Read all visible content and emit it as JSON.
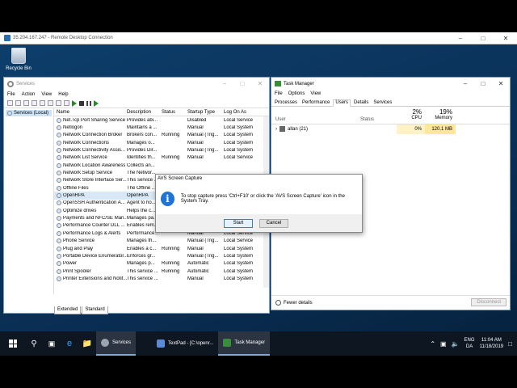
{
  "rdp": {
    "title": "35.204.167.247 - Remote Desktop Connection"
  },
  "desktop": {
    "recycle_bin": "Recycle Bin"
  },
  "services": {
    "title": "Services",
    "menu": [
      "File",
      "Action",
      "View",
      "Help"
    ],
    "tree_node": "Services (Local)",
    "headers": {
      "name": "Name",
      "description": "Description",
      "status": "Status",
      "startup": "Startup Type",
      "logon": "Log On As"
    },
    "rows": [
      {
        "name": "Net.Tcp Port Sharing Service",
        "desc": "Provides abi...",
        "status": "",
        "startup": "Disabled",
        "logon": "Local Service"
      },
      {
        "name": "Netlogon",
        "desc": "Maintains a ...",
        "status": "",
        "startup": "Manual",
        "logon": "Local System"
      },
      {
        "name": "Network Connection Broker",
        "desc": "Brokers con...",
        "status": "Running",
        "startup": "Manual (Trig...",
        "logon": "Local System"
      },
      {
        "name": "Network Connections",
        "desc": "Manages o...",
        "status": "",
        "startup": "Manual",
        "logon": "Local System"
      },
      {
        "name": "Network Connectivity Assis...",
        "desc": "Provides Dir...",
        "status": "",
        "startup": "Manual (Trig...",
        "logon": "Local System"
      },
      {
        "name": "Network List Service",
        "desc": "Identifies th...",
        "status": "Running",
        "startup": "Manual",
        "logon": "Local Service"
      },
      {
        "name": "Network Location Awareness",
        "desc": "Collects an...",
        "status": "",
        "startup": "",
        "logon": ""
      },
      {
        "name": "Network Setup Service",
        "desc": "The Networ...",
        "status": "",
        "startup": "",
        "logon": ""
      },
      {
        "name": "Network Store Interface Ser...",
        "desc": "This service ...",
        "status": "",
        "startup": "",
        "logon": ""
      },
      {
        "name": "Offline Files",
        "desc": "The Offline ...",
        "status": "",
        "startup": "",
        "logon": ""
      },
      {
        "name": "OpenRPA",
        "desc": "OpenRPA",
        "status": "",
        "startup": "",
        "logon": ""
      },
      {
        "name": "OpenSSH Authentication A...",
        "desc": "Agent to ho...",
        "status": "",
        "startup": "",
        "logon": ""
      },
      {
        "name": "Optimize drives",
        "desc": "Helps the c...",
        "status": "",
        "startup": "",
        "logon": ""
      },
      {
        "name": "Payments and NFC/SE Man...",
        "desc": "Manages pa...",
        "status": "",
        "startup": "Manual (Trig...",
        "logon": "Local Service"
      },
      {
        "name": "Performance Counter DLL ...",
        "desc": "Enables rem...",
        "status": "",
        "startup": "Manual",
        "logon": "Local Service"
      },
      {
        "name": "Performance Logs & Alerts",
        "desc": "Performance...",
        "status": "",
        "startup": "Manual",
        "logon": "Local Service"
      },
      {
        "name": "Phone Service",
        "desc": "Manages th...",
        "status": "",
        "startup": "Manual (Trig...",
        "logon": "Local Service"
      },
      {
        "name": "Plug and Play",
        "desc": "Enables a c...",
        "status": "Running",
        "startup": "Manual",
        "logon": "Local System"
      },
      {
        "name": "Portable Device Enumerator...",
        "desc": "Enforces gr...",
        "status": "",
        "startup": "Manual (Trig...",
        "logon": "Local System"
      },
      {
        "name": "Power",
        "desc": "Manages p...",
        "status": "Running",
        "startup": "Automatic",
        "logon": "Local System"
      },
      {
        "name": "Print Spooler",
        "desc": "This service ...",
        "status": "Running",
        "startup": "Automatic",
        "logon": "Local System"
      },
      {
        "name": "Printer Extensions and Notif...",
        "desc": "This service ...",
        "status": "",
        "startup": "Manual",
        "logon": "Local System"
      }
    ],
    "tabs": [
      "Extended",
      "Standard"
    ]
  },
  "taskmanager": {
    "title": "Task Manager",
    "menu": [
      "File",
      "Options",
      "View"
    ],
    "tabs": [
      "Processes",
      "Performance",
      "Users",
      "Details",
      "Services"
    ],
    "active_tab": "Users",
    "cols": {
      "user": "User",
      "status": "Status",
      "cpu_pct": "2%",
      "cpu": "CPU",
      "mem_pct": "19%",
      "mem": "Memory"
    },
    "user_row": {
      "name": "allan (21)",
      "cpu": "0%",
      "mem": "120.1 MB"
    },
    "fewer": "Fewer details",
    "disconnect": "Disconnect"
  },
  "dialog": {
    "title": "AVS Screen Capture",
    "message": "To stop capture press 'Ctrl+F10' or click the 'AVS Screen Capture' icon in the System Tray.",
    "start": "Start",
    "cancel": "Cancel"
  },
  "taskbar": {
    "tasks": [
      {
        "label": "Services"
      },
      {
        "label": "TextPad - [C:\\openr..."
      },
      {
        "label": "Task Manager"
      }
    ],
    "lang_top": "ENG",
    "lang_bottom": "DA",
    "time": "11:04 AM",
    "date": "11/18/2019"
  }
}
